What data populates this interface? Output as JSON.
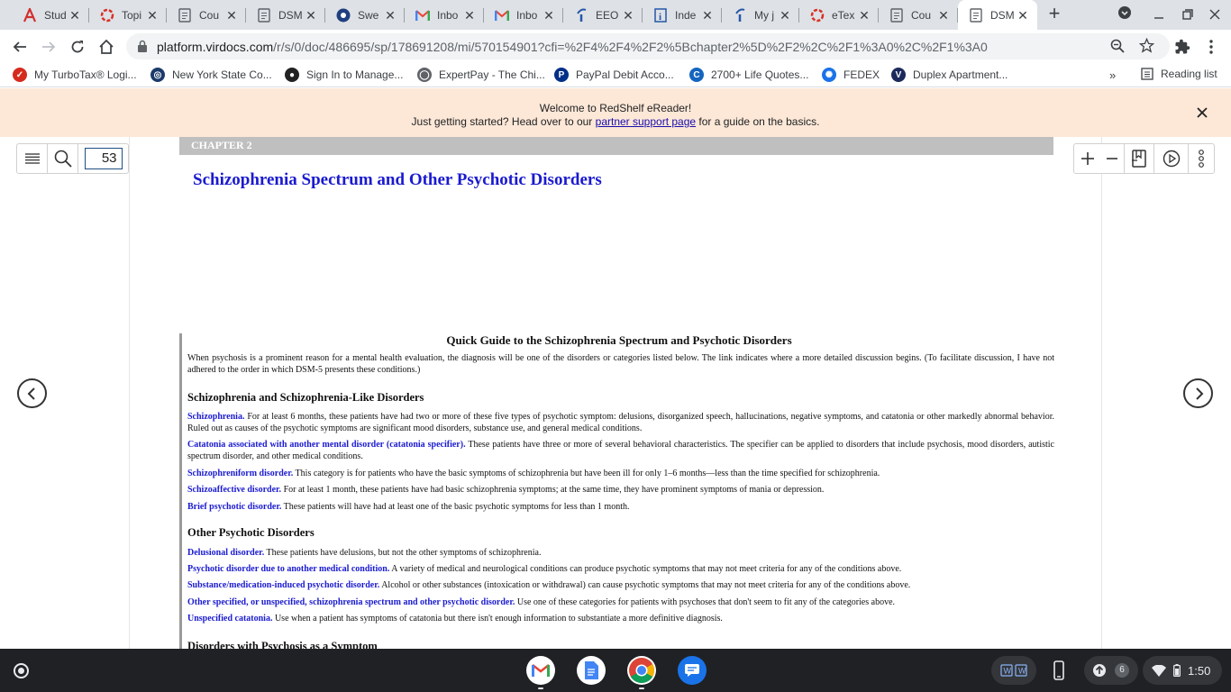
{
  "tabs": [
    {
      "label": "Stud",
      "icon": "azure-a-icon"
    },
    {
      "label": "Topi",
      "icon": "red-ring-icon"
    },
    {
      "label": "Cou",
      "icon": "document-icon"
    },
    {
      "label": "DSM",
      "icon": "document-icon"
    },
    {
      "label": "Swe",
      "icon": "globe-icon"
    },
    {
      "label": "Inbo",
      "icon": "gmail-icon"
    },
    {
      "label": "Inbo",
      "icon": "gmail-icon"
    },
    {
      "label": "EEO",
      "icon": "indeed-icon"
    },
    {
      "label": "Inde",
      "icon": "info-icon"
    },
    {
      "label": "My j",
      "icon": "indeed-icon"
    },
    {
      "label": "eTex",
      "icon": "red-ring-icon"
    },
    {
      "label": "Cou",
      "icon": "document-icon"
    },
    {
      "label": "DSM",
      "icon": "document-icon",
      "active": true
    }
  ],
  "omnibox": {
    "host": "platform.virdocs.com",
    "path": "/r/s/0/doc/486695/sp/178691208/mi/570154901?cfi=%2F4%2F4%2F2%5Bchapter2%5D%2F2%2C%2F1%3A0%2C%2F1%3A0"
  },
  "bookmarks": [
    {
      "label": "My TurboTax® Logi...",
      "color": "#d52b1e"
    },
    {
      "label": "New York State Co...",
      "color": "#1b3a6b"
    },
    {
      "label": "Sign In to Manage...",
      "color": "#222222"
    },
    {
      "label": "ExpertPay - The Chi...",
      "color": "#5f6368"
    },
    {
      "label": "PayPal Debit Acco...",
      "color": "#003087"
    },
    {
      "label": "2700+ Life Quotes...",
      "color": "#1565c0"
    },
    {
      "label": "FEDEX",
      "color": "#1a73e8"
    },
    {
      "label": "Duplex Apartment...",
      "color": "#1b2a5b"
    }
  ],
  "reading_list": "Reading list",
  "banner": {
    "line1": "Welcome to RedShelf eReader!",
    "line2_pre": "Just getting started? Head over to our ",
    "line2_link": "partner support page",
    "line2_post": " for a guide on the basics."
  },
  "reader": {
    "page_number": "53",
    "chapter_label": "CHAPTER 2",
    "chapter_title": "Schizophrenia Spectrum and Other Psychotic Disorders"
  },
  "guide": {
    "title": "Quick Guide to the Schizophrenia Spectrum and Psychotic Disorders",
    "intro": "When psychosis is a prominent reason for a mental health evaluation, the diagnosis will be one of the disorders or categories listed below. The link indicates where a more detailed discussion begins. (To facilitate discussion, I have not adhered to the order in which DSM-5 presents these conditions.)",
    "section1": "Schizophrenia and Schizophrenia-Like Disorders",
    "items1": [
      {
        "link": "Schizophrenia.",
        "text": " For at least 6 months, these patients have had two or more of these five types of psychotic symptom: delusions, disorganized speech, hallucinations, negative symptoms, and catatonia or other markedly abnormal behavior. Ruled out as causes of the psychotic symptoms are significant mood disorders, substance use, and general medical conditions."
      },
      {
        "link": "Catatonia associated with another mental disorder (catatonia specifier).",
        "text": " These patients have three or more of several behavioral characteristics. The specifier can be applied to disorders that include psychosis, mood disorders, autistic spectrum disorder, and other medical conditions."
      },
      {
        "link": "Schizophreniform disorder.",
        "text": " This category is for patients who have the basic symptoms of schizophrenia but have been ill for only 1–6 months—less than the time specified for schizophrenia."
      },
      {
        "link": "Schizoaffective disorder.",
        "text": " For at least 1 month, these patients have had basic schizophrenia symptoms; at the same time, they have prominent symptoms of mania or depression."
      },
      {
        "link": "Brief psychotic disorder.",
        "text": " These patients will have had at least one of the basic psychotic symptoms for less than 1 month."
      }
    ],
    "section2": "Other Psychotic Disorders",
    "items2": [
      {
        "link": "Delusional disorder.",
        "text": " These patients have delusions, but not the other symptoms of schizophrenia."
      },
      {
        "link": "Psychotic disorder due to another medical condition.",
        "text": " A variety of medical and neurological conditions can produce psychotic symptoms that may not meet criteria for any of the conditions above."
      },
      {
        "link": "Substance/medication-induced psychotic disorder.",
        "text": " Alcohol or other substances (intoxication or withdrawal) can cause psychotic symptoms that may not meet criteria for any of the conditions above."
      },
      {
        "link": "Other specified, or unspecified, schizophrenia spectrum and other psychotic disorder.",
        "text": " Use one of these categories for patients with psychoses that don't seem to fit any of the categories above."
      },
      {
        "link": "Unspecified catatonia.",
        "text": " Use when a patient has symptoms of catatonia but there isn't enough information to substantiate a more definitive diagnosis."
      }
    ],
    "section3": "Disorders with Psychosis as a Symptom"
  },
  "shelf": {
    "notification_count": "6",
    "time": "1:50"
  }
}
